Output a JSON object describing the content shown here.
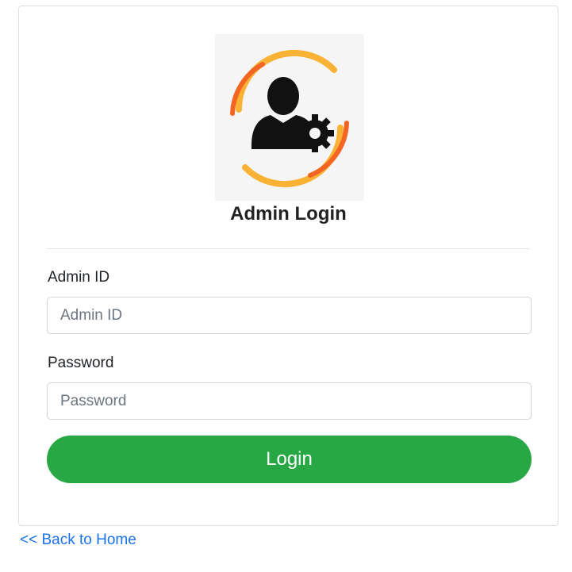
{
  "login": {
    "title": "Admin Login",
    "admin_id_label": "Admin ID",
    "admin_id_placeholder": "Admin ID",
    "admin_id_value": "",
    "password_label": "Password",
    "password_placeholder": "Password",
    "password_value": "",
    "login_button": "Login",
    "logo_icon": "admin-user-gear-icon"
  },
  "footer": {
    "back_link": "<< Back to Home"
  },
  "colors": {
    "login_button": "#28a745",
    "link": "#1a73e8",
    "logo_ring_orange": "#f26522",
    "logo_ring_yellow": "#f9b233"
  }
}
